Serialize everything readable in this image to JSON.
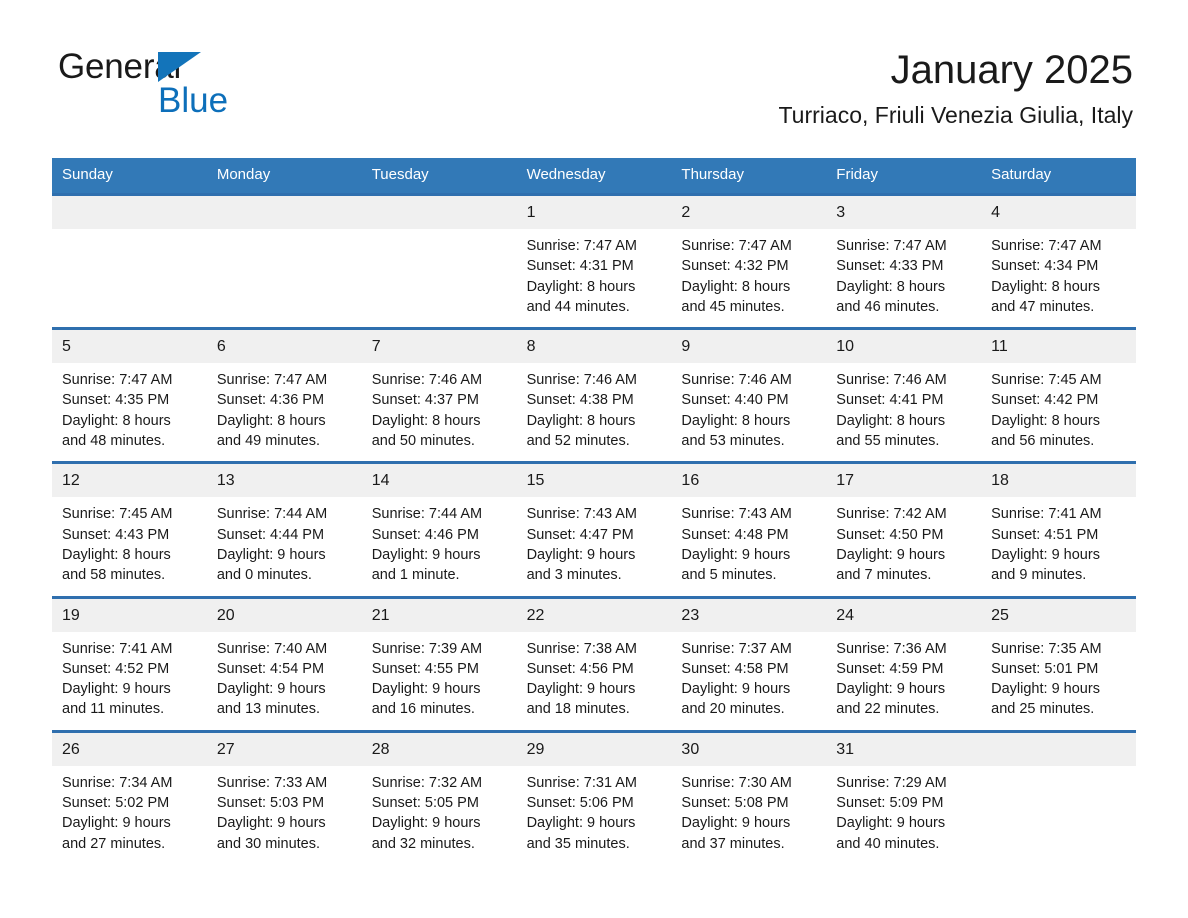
{
  "brand": {
    "name_part1": "General",
    "name_part2": "Blue",
    "triangle_icon": "triangle-icon",
    "color_blue": "#0d6fba",
    "color_triangle": "#1374ba"
  },
  "header": {
    "title": "January 2025",
    "subtitle": "Turriaco, Friuli Venezia Giulia, Italy"
  },
  "theme": {
    "header_bar": "#3279b7",
    "week_divider": "#2f6fae",
    "daynum_band": "#f0f0f0",
    "text": "#1a1a1a"
  },
  "weekdays": [
    "Sunday",
    "Monday",
    "Tuesday",
    "Wednesday",
    "Thursday",
    "Friday",
    "Saturday"
  ],
  "weeks": [
    {
      "days": [
        {
          "num": "",
          "sunrise": "",
          "sunset": "",
          "daylight_line1": "",
          "daylight_line2": ""
        },
        {
          "num": "",
          "sunrise": "",
          "sunset": "",
          "daylight_line1": "",
          "daylight_line2": ""
        },
        {
          "num": "",
          "sunrise": "",
          "sunset": "",
          "daylight_line1": "",
          "daylight_line2": ""
        },
        {
          "num": "1",
          "sunrise": "Sunrise: 7:47 AM",
          "sunset": "Sunset: 4:31 PM",
          "daylight_line1": "Daylight: 8 hours",
          "daylight_line2": "and 44 minutes."
        },
        {
          "num": "2",
          "sunrise": "Sunrise: 7:47 AM",
          "sunset": "Sunset: 4:32 PM",
          "daylight_line1": "Daylight: 8 hours",
          "daylight_line2": "and 45 minutes."
        },
        {
          "num": "3",
          "sunrise": "Sunrise: 7:47 AM",
          "sunset": "Sunset: 4:33 PM",
          "daylight_line1": "Daylight: 8 hours",
          "daylight_line2": "and 46 minutes."
        },
        {
          "num": "4",
          "sunrise": "Sunrise: 7:47 AM",
          "sunset": "Sunset: 4:34 PM",
          "daylight_line1": "Daylight: 8 hours",
          "daylight_line2": "and 47 minutes."
        }
      ]
    },
    {
      "days": [
        {
          "num": "5",
          "sunrise": "Sunrise: 7:47 AM",
          "sunset": "Sunset: 4:35 PM",
          "daylight_line1": "Daylight: 8 hours",
          "daylight_line2": "and 48 minutes."
        },
        {
          "num": "6",
          "sunrise": "Sunrise: 7:47 AM",
          "sunset": "Sunset: 4:36 PM",
          "daylight_line1": "Daylight: 8 hours",
          "daylight_line2": "and 49 minutes."
        },
        {
          "num": "7",
          "sunrise": "Sunrise: 7:46 AM",
          "sunset": "Sunset: 4:37 PM",
          "daylight_line1": "Daylight: 8 hours",
          "daylight_line2": "and 50 minutes."
        },
        {
          "num": "8",
          "sunrise": "Sunrise: 7:46 AM",
          "sunset": "Sunset: 4:38 PM",
          "daylight_line1": "Daylight: 8 hours",
          "daylight_line2": "and 52 minutes."
        },
        {
          "num": "9",
          "sunrise": "Sunrise: 7:46 AM",
          "sunset": "Sunset: 4:40 PM",
          "daylight_line1": "Daylight: 8 hours",
          "daylight_line2": "and 53 minutes."
        },
        {
          "num": "10",
          "sunrise": "Sunrise: 7:46 AM",
          "sunset": "Sunset: 4:41 PM",
          "daylight_line1": "Daylight: 8 hours",
          "daylight_line2": "and 55 minutes."
        },
        {
          "num": "11",
          "sunrise": "Sunrise: 7:45 AM",
          "sunset": "Sunset: 4:42 PM",
          "daylight_line1": "Daylight: 8 hours",
          "daylight_line2": "and 56 minutes."
        }
      ]
    },
    {
      "days": [
        {
          "num": "12",
          "sunrise": "Sunrise: 7:45 AM",
          "sunset": "Sunset: 4:43 PM",
          "daylight_line1": "Daylight: 8 hours",
          "daylight_line2": "and 58 minutes."
        },
        {
          "num": "13",
          "sunrise": "Sunrise: 7:44 AM",
          "sunset": "Sunset: 4:44 PM",
          "daylight_line1": "Daylight: 9 hours",
          "daylight_line2": "and 0 minutes."
        },
        {
          "num": "14",
          "sunrise": "Sunrise: 7:44 AM",
          "sunset": "Sunset: 4:46 PM",
          "daylight_line1": "Daylight: 9 hours",
          "daylight_line2": "and 1 minute."
        },
        {
          "num": "15",
          "sunrise": "Sunrise: 7:43 AM",
          "sunset": "Sunset: 4:47 PM",
          "daylight_line1": "Daylight: 9 hours",
          "daylight_line2": "and 3 minutes."
        },
        {
          "num": "16",
          "sunrise": "Sunrise: 7:43 AM",
          "sunset": "Sunset: 4:48 PM",
          "daylight_line1": "Daylight: 9 hours",
          "daylight_line2": "and 5 minutes."
        },
        {
          "num": "17",
          "sunrise": "Sunrise: 7:42 AM",
          "sunset": "Sunset: 4:50 PM",
          "daylight_line1": "Daylight: 9 hours",
          "daylight_line2": "and 7 minutes."
        },
        {
          "num": "18",
          "sunrise": "Sunrise: 7:41 AM",
          "sunset": "Sunset: 4:51 PM",
          "daylight_line1": "Daylight: 9 hours",
          "daylight_line2": "and 9 minutes."
        }
      ]
    },
    {
      "days": [
        {
          "num": "19",
          "sunrise": "Sunrise: 7:41 AM",
          "sunset": "Sunset: 4:52 PM",
          "daylight_line1": "Daylight: 9 hours",
          "daylight_line2": "and 11 minutes."
        },
        {
          "num": "20",
          "sunrise": "Sunrise: 7:40 AM",
          "sunset": "Sunset: 4:54 PM",
          "daylight_line1": "Daylight: 9 hours",
          "daylight_line2": "and 13 minutes."
        },
        {
          "num": "21",
          "sunrise": "Sunrise: 7:39 AM",
          "sunset": "Sunset: 4:55 PM",
          "daylight_line1": "Daylight: 9 hours",
          "daylight_line2": "and 16 minutes."
        },
        {
          "num": "22",
          "sunrise": "Sunrise: 7:38 AM",
          "sunset": "Sunset: 4:56 PM",
          "daylight_line1": "Daylight: 9 hours",
          "daylight_line2": "and 18 minutes."
        },
        {
          "num": "23",
          "sunrise": "Sunrise: 7:37 AM",
          "sunset": "Sunset: 4:58 PM",
          "daylight_line1": "Daylight: 9 hours",
          "daylight_line2": "and 20 minutes."
        },
        {
          "num": "24",
          "sunrise": "Sunrise: 7:36 AM",
          "sunset": "Sunset: 4:59 PM",
          "daylight_line1": "Daylight: 9 hours",
          "daylight_line2": "and 22 minutes."
        },
        {
          "num": "25",
          "sunrise": "Sunrise: 7:35 AM",
          "sunset": "Sunset: 5:01 PM",
          "daylight_line1": "Daylight: 9 hours",
          "daylight_line2": "and 25 minutes."
        }
      ]
    },
    {
      "days": [
        {
          "num": "26",
          "sunrise": "Sunrise: 7:34 AM",
          "sunset": "Sunset: 5:02 PM",
          "daylight_line1": "Daylight: 9 hours",
          "daylight_line2": "and 27 minutes."
        },
        {
          "num": "27",
          "sunrise": "Sunrise: 7:33 AM",
          "sunset": "Sunset: 5:03 PM",
          "daylight_line1": "Daylight: 9 hours",
          "daylight_line2": "and 30 minutes."
        },
        {
          "num": "28",
          "sunrise": "Sunrise: 7:32 AM",
          "sunset": "Sunset: 5:05 PM",
          "daylight_line1": "Daylight: 9 hours",
          "daylight_line2": "and 32 minutes."
        },
        {
          "num": "29",
          "sunrise": "Sunrise: 7:31 AM",
          "sunset": "Sunset: 5:06 PM",
          "daylight_line1": "Daylight: 9 hours",
          "daylight_line2": "and 35 minutes."
        },
        {
          "num": "30",
          "sunrise": "Sunrise: 7:30 AM",
          "sunset": "Sunset: 5:08 PM",
          "daylight_line1": "Daylight: 9 hours",
          "daylight_line2": "and 37 minutes."
        },
        {
          "num": "31",
          "sunrise": "Sunrise: 7:29 AM",
          "sunset": "Sunset: 5:09 PM",
          "daylight_line1": "Daylight: 9 hours",
          "daylight_line2": "and 40 minutes."
        },
        {
          "num": "",
          "sunrise": "",
          "sunset": "",
          "daylight_line1": "",
          "daylight_line2": ""
        }
      ]
    }
  ]
}
